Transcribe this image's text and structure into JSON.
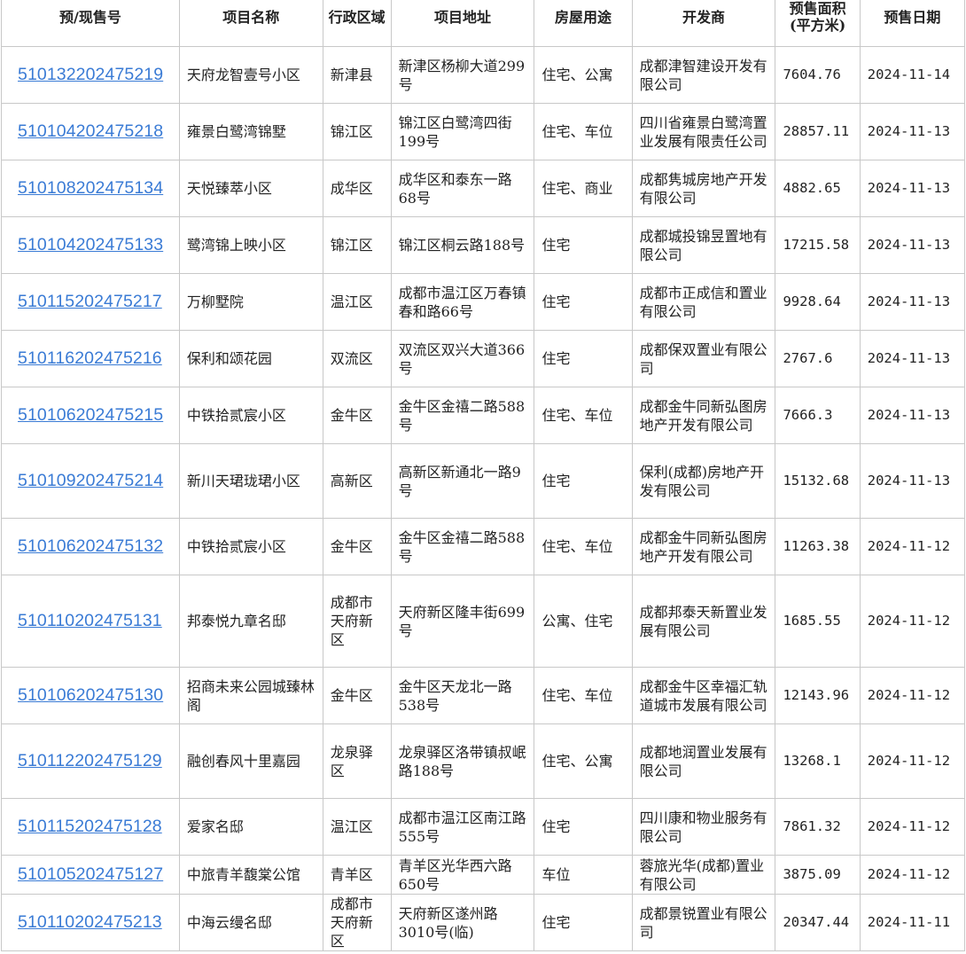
{
  "headers": {
    "permit": "预/现售号",
    "name": "项目名称",
    "district": "行政区域",
    "address": "项目地址",
    "usage": "房屋用途",
    "developer": "开发商",
    "area_line1": "预售面积",
    "area_line2": "(平方米)",
    "date": "预售日期"
  },
  "rows": [
    {
      "permit": "510132202475219",
      "name": "天府龙智壹号小区",
      "district": "新津县",
      "address": "新津区杨柳大道299号",
      "usage": "住宅、公寓",
      "developer": "成都津智建设开发有限公司",
      "area": "7604.76",
      "date": "2024-11-14"
    },
    {
      "permit": "510104202475218",
      "name": "雍景白鹭湾锦墅",
      "district": "锦江区",
      "address": "锦江区白鹭湾四街199号",
      "usage": "住宅、车位",
      "developer": "四川省雍景白鹭湾置业发展有限责任公司",
      "area": "28857.11",
      "date": "2024-11-13"
    },
    {
      "permit": "510108202475134",
      "name": "天悦臻萃小区",
      "district": "成华区",
      "address": "成华区和泰东一路68号",
      "usage": "住宅、商业",
      "developer": "成都隽城房地产开发有限公司",
      "area": "4882.65",
      "date": "2024-11-13"
    },
    {
      "permit": "510104202475133",
      "name": "鹭湾锦上映小区",
      "district": "锦江区",
      "address": "锦江区桐云路188号",
      "usage": "住宅",
      "developer": "成都城投锦昱置地有限公司",
      "area": "17215.58",
      "date": "2024-11-13"
    },
    {
      "permit": "510115202475217",
      "name": "万柳墅院",
      "district": "温江区",
      "address": "成都市温江区万春镇春和路66号",
      "usage": "住宅",
      "developer": "成都市正成信和置业有限公司",
      "area": "9928.64",
      "date": "2024-11-13"
    },
    {
      "permit": "510116202475216",
      "name": "保利和颂花园",
      "district": "双流区",
      "address": "双流区双兴大道366号",
      "usage": "住宅",
      "developer": "成都保双置业有限公司",
      "area": "2767.6",
      "date": "2024-11-13"
    },
    {
      "permit": "510106202475215",
      "name": "中铁拾贰宸小区",
      "district": "金牛区",
      "address": "金牛区金禧二路588号",
      "usage": "住宅、车位",
      "developer": "成都金牛同新弘图房地产开发有限公司",
      "area": "7666.3",
      "date": "2024-11-13"
    },
    {
      "permit": "510109202475214",
      "name": "新川天珺珑珺小区",
      "district": "高新区",
      "address": "高新区新通北一路9号",
      "usage": "住宅",
      "developer": "保利(成都)房地产开发有限公司",
      "area": "15132.68",
      "date": "2024-11-13"
    },
    {
      "permit": "510106202475132",
      "name": "中铁拾贰宸小区",
      "district": "金牛区",
      "address": "金牛区金禧二路588号",
      "usage": "住宅、车位",
      "developer": "成都金牛同新弘图房地产开发有限公司",
      "area": "11263.38",
      "date": "2024-11-12"
    },
    {
      "permit": "510110202475131",
      "name": "邦泰悦九章名邸",
      "district": "成都市天府新区",
      "address": "天府新区隆丰街699号",
      "usage": "公寓、住宅",
      "developer": "成都邦泰天新置业发展有限公司",
      "area": "1685.55",
      "date": "2024-11-12"
    },
    {
      "permit": "510106202475130",
      "name": "招商未来公园城臻林阁",
      "district": "金牛区",
      "address": "金牛区天龙北一路538号",
      "usage": "住宅、车位",
      "developer": "成都金牛区幸福汇轨道城市发展有限公司",
      "area": "12143.96",
      "date": "2024-11-12"
    },
    {
      "permit": "510112202475129",
      "name": "融创春风十里嘉园",
      "district": "龙泉驿区",
      "address": "龙泉驿区洛带镇叔岷路188号",
      "usage": "住宅、公寓",
      "developer": "成都地润置业发展有限公司",
      "area": "13268.1",
      "date": "2024-11-12"
    },
    {
      "permit": "510115202475128",
      "name": "爱家名邸",
      "district": "温江区",
      "address": "成都市温江区南江路555号",
      "usage": "住宅",
      "developer": "四川康和物业服务有限公司",
      "area": "7861.32",
      "date": "2024-11-12"
    },
    {
      "permit": "510105202475127",
      "name": "中旅青羊馥棠公馆",
      "district": "青羊区",
      "address": "青羊区光华西六路650号",
      "usage": "车位",
      "developer": "蓉旅光华(成都)置业有限公司",
      "area": "3875.09",
      "date": "2024-11-12"
    },
    {
      "permit": "510110202475213",
      "name": "中海云缦名邸",
      "district": "成都市天府新区",
      "address": "天府新区遂州路3010号(临)",
      "usage": "住宅",
      "developer": "成都景锐置业有限公司",
      "area": "20347.44",
      "date": "2024-11-11"
    }
  ]
}
